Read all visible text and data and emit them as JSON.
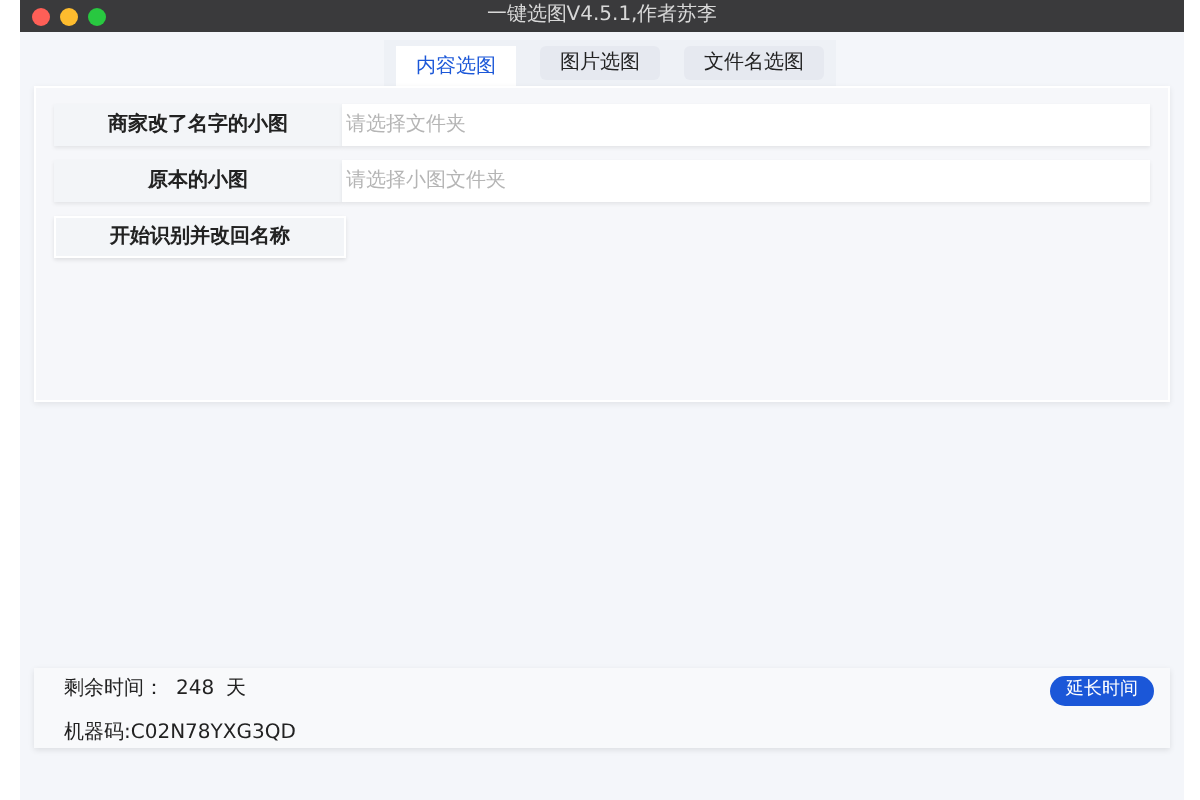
{
  "window": {
    "title": "一键选图V4.5.1,作者苏李"
  },
  "tabs": [
    {
      "label": "内容选图",
      "selected": true
    },
    {
      "label": "图片选图",
      "selected": false
    },
    {
      "label": "文件名选图",
      "selected": false
    }
  ],
  "folder_rows": [
    {
      "button": "商家改了名字的小图",
      "placeholder": "请选择文件夹"
    },
    {
      "button": "原本的小图",
      "placeholder": "请选择小图文件夹"
    }
  ],
  "start_button": "开始识别并改回名称",
  "footer": {
    "remaining_label": "剩余时间：",
    "remaining_value": "248",
    "remaining_unit": "天",
    "machine_code": "机器码:C02N78YXG3QD",
    "extend_button": "延长时间"
  }
}
